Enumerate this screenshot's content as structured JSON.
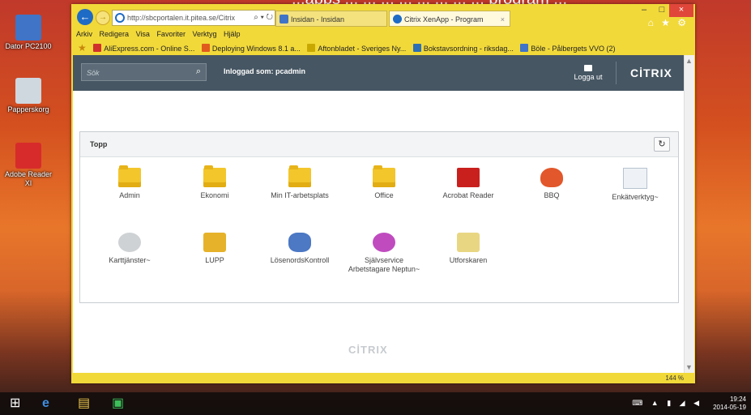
{
  "overlay_title": "...apps ... ... ... ... ... ... ... ... program ...",
  "desktop": {
    "icons": [
      {
        "label": "Dator PC2100",
        "color": "#3f74c7"
      },
      {
        "label": "Papperskorg",
        "color": "#cfd7df"
      },
      {
        "label": "Adobe Reader XI",
        "color": "#d72b2b"
      }
    ]
  },
  "browser": {
    "address": "http://sbcportalen.it.pitea.se/Citrix",
    "address_controls": "⌕ ▾ ↻",
    "tabs": [
      {
        "label": "Insidan - Insidan",
        "color": "#3f74c7"
      },
      {
        "label": "Citrix XenApp - Program",
        "color": "#1e6bc5",
        "close": "×"
      }
    ],
    "window_controls": {
      "minimize": "–",
      "maximize": "□",
      "close": "×"
    },
    "right_icons": "⌂ ★ ⚙",
    "menu": [
      "Arkiv",
      "Redigera",
      "Visa",
      "Favoriter",
      "Verktyg",
      "Hjälp"
    ],
    "favorites": [
      {
        "label": "AliExpress.com - Online S...",
        "color": "#d0312d"
      },
      {
        "label": "Deploying Windows 8.1 a...",
        "color": "#e05a1e"
      },
      {
        "label": "Aftonbladet - Sveriges Ny...",
        "color": "#c8a800"
      },
      {
        "label": "Bokstavsordning - riksdag...",
        "color": "#2c6fb5"
      },
      {
        "label": "Böle - Pålbergets VVO (2)",
        "color": "#3f74c7"
      }
    ],
    "zoom": "144 %"
  },
  "citrix": {
    "search_placeholder": "Sök",
    "logged_in": "Inloggad som: pcadmin",
    "logout": "Logga ut",
    "brand": "CİTRIX",
    "panel_title": "Topp",
    "refresh": "↻",
    "footer_brand": "CİTRIX",
    "apps": [
      {
        "label": "Admin",
        "icon": "folder-icon"
      },
      {
        "label": "Ekonomi",
        "icon": "folder-icon"
      },
      {
        "label": "Min IT-arbetsplats",
        "icon": "folder-icon"
      },
      {
        "label": "Office",
        "icon": "folder-icon"
      },
      {
        "label": "Acrobat Reader",
        "icon": "acrobat-icon"
      },
      {
        "label": "BBQ",
        "icon": "flame-icon"
      },
      {
        "label": "Enkätverktyg~",
        "icon": "notepad-icon"
      },
      {
        "label": "Karttjänster~",
        "icon": "map-icon"
      },
      {
        "label": "LUPP",
        "icon": "lupp-icon"
      },
      {
        "label": "LösenordsKontroll",
        "icon": "keys-icon"
      },
      {
        "label": "Självservice Arbetstagare Neptun~",
        "icon": "selfservice-icon"
      },
      {
        "label": "Utforskaren",
        "icon": "explorer-icon"
      }
    ]
  },
  "taskbar": {
    "time": "19:24",
    "date": "2014-05-19"
  }
}
